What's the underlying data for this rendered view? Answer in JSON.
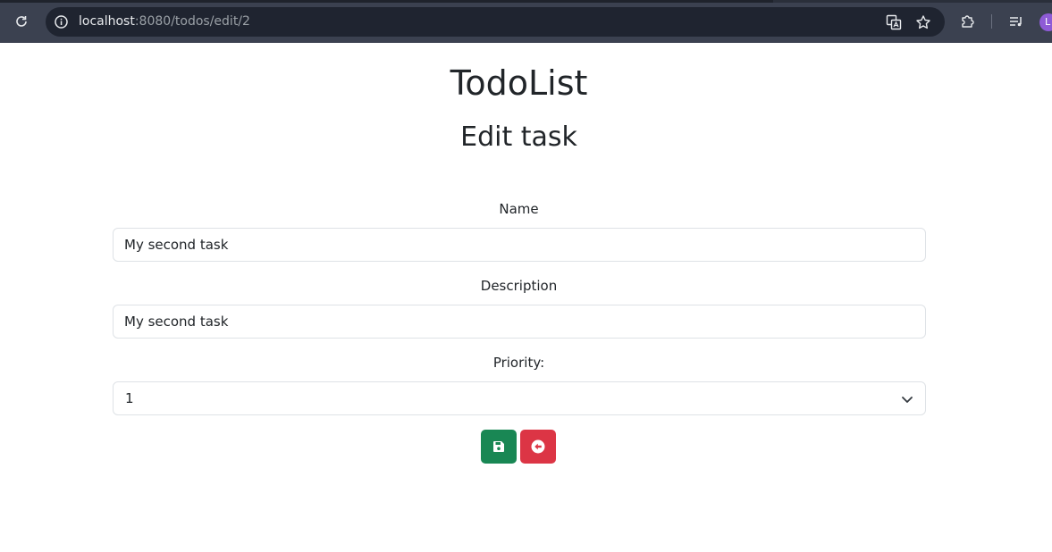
{
  "browser": {
    "url_host": "localhost",
    "url_path": ":8080/todos/edit/2",
    "avatar_letter": "L"
  },
  "page": {
    "app_title": "TodoList",
    "heading": "Edit task"
  },
  "form": {
    "name_label": "Name",
    "name_value": "My second task",
    "description_label": "Description",
    "description_value": "My second task",
    "priority_label": "Priority:",
    "priority_selected": "1"
  },
  "colors": {
    "save_button": "#198754",
    "back_button": "#dc3545",
    "browser_toolbar": "#3b4150",
    "omnibox": "#1f2430"
  },
  "icons": {
    "save": "floppy-disk-icon",
    "back": "circle-arrow-left-icon"
  }
}
